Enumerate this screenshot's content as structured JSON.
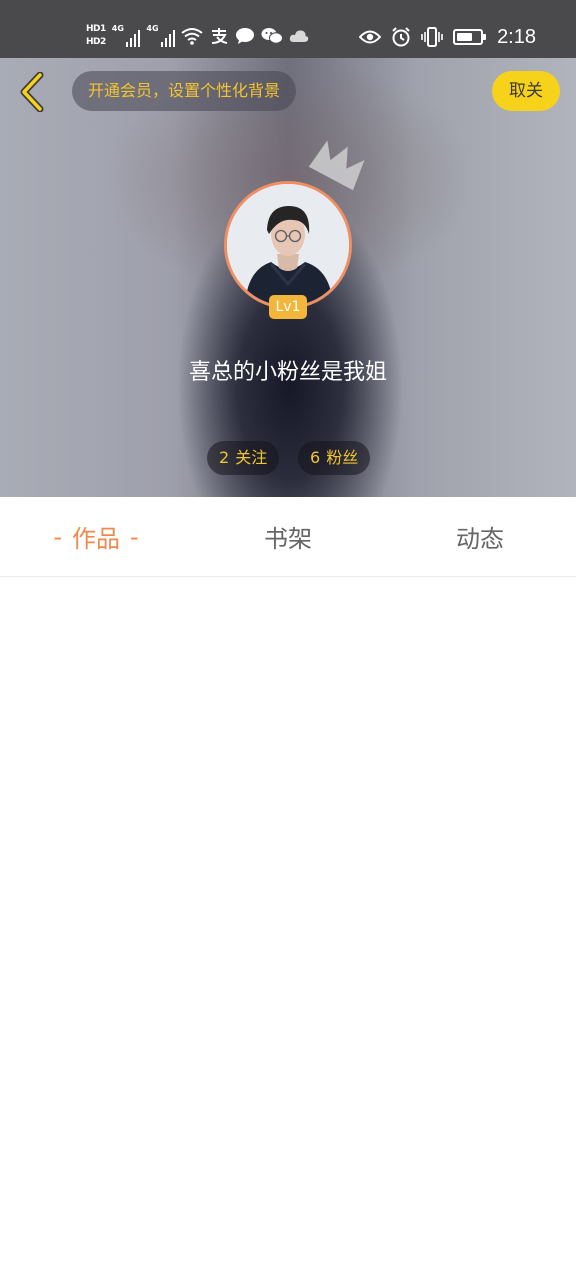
{
  "status_bar": {
    "hd_badges": [
      "HD1",
      "HD2"
    ],
    "network_labels": [
      "4G",
      "4G"
    ],
    "battery_level": 0.7,
    "time": "2:18",
    "left_icons": [
      "alipay-icon",
      "message-icon",
      "wechat-icon",
      "cloud-icon"
    ],
    "right_icons": [
      "eye-icon",
      "alarm-icon",
      "vibrate-icon",
      "battery-icon"
    ]
  },
  "header": {
    "member_banner": "开通会员，设置个性化背景",
    "unfollow_label": "取关",
    "back_icon": "chevron-left-icon",
    "crown_icon": "crown-icon",
    "accent_color": "#f6d21b",
    "banner_text_color": "#f4c430"
  },
  "profile": {
    "avatar": "avatar-photo",
    "level": "Lv1",
    "username": "喜总的小粉丝是我姐",
    "following_count": "2",
    "following_label": "关注",
    "followers_count": "6",
    "followers_label": "粉丝",
    "ring_color": "#ef8f62"
  },
  "tabs": [
    {
      "label": "作品",
      "active": true,
      "dash": "-"
    },
    {
      "label": "书架",
      "active": false
    },
    {
      "label": "动态",
      "active": false
    }
  ],
  "active_tab_color": "#ef8a4e"
}
